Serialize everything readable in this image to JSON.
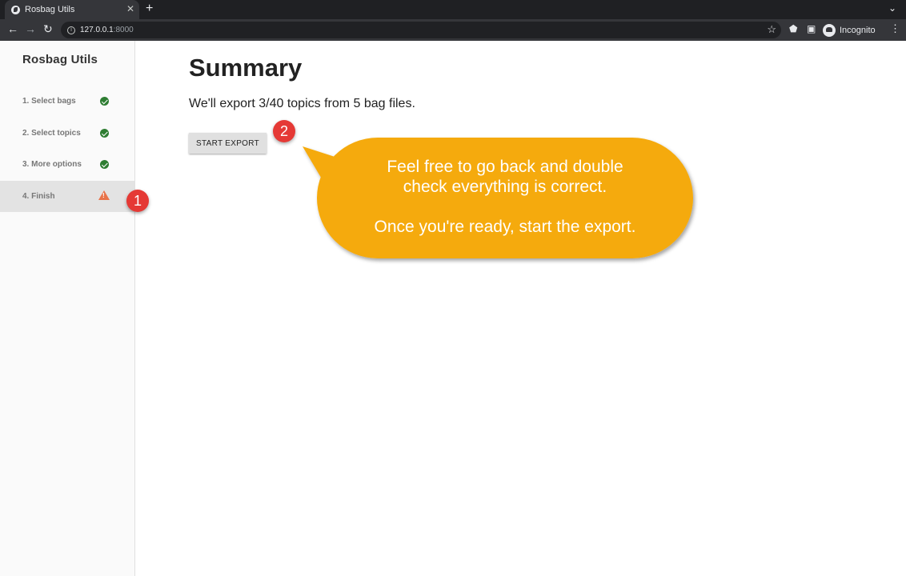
{
  "browser": {
    "tab_title": "Rosbag Utils",
    "tab_close": "✕",
    "new_tab": "+",
    "tabs_menu": "⌄",
    "back": "←",
    "forward": "→",
    "reload": "↻",
    "info_glyph": "i",
    "url_host": "127.0.0.1",
    "url_port": ":8000",
    "bookmark": "☆",
    "extensions": "⬟",
    "sidepanel": "▣",
    "profile_label": "Incognito",
    "menu": "⋮"
  },
  "sidebar": {
    "brand": "Rosbag Utils",
    "steps": [
      {
        "label": "1. Select bags",
        "status": "done"
      },
      {
        "label": "2. Select topics",
        "status": "done"
      },
      {
        "label": "3. More options",
        "status": "done"
      },
      {
        "label": "4. Finish",
        "status": "warning"
      }
    ]
  },
  "main": {
    "title": "Summary",
    "summary": "We'll export 3/40 topics from 5 bag files.",
    "start_button": "START EXPORT"
  },
  "annotations": {
    "badge_1": "1",
    "badge_2": "2",
    "bubble_line_1": "Feel free to go back and double",
    "bubble_line_2": "check everything is correct.",
    "bubble_line_3": "Once you're ready, start the export.",
    "bubble_color": "#f5aa0a",
    "badge_color": "#e53935"
  },
  "colors": {
    "check": "#2e7d32",
    "warning": "#e8734a"
  }
}
